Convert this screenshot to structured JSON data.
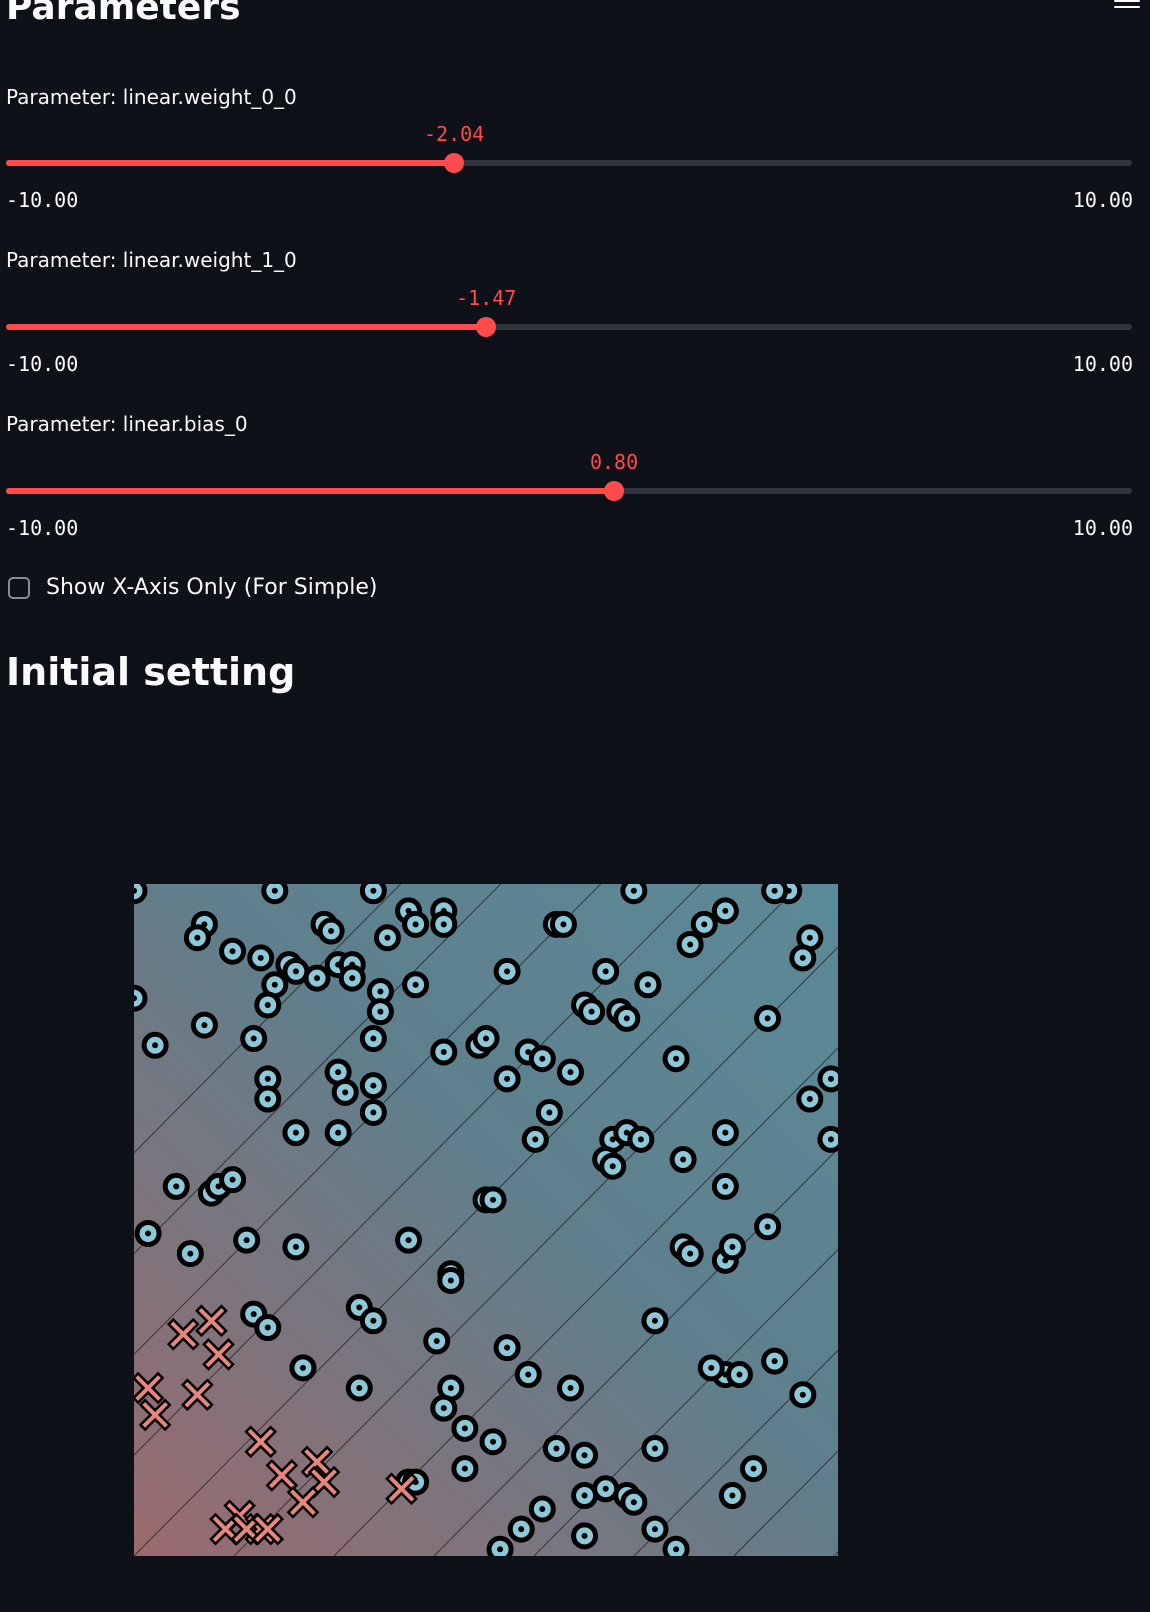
{
  "header": {
    "title": "Parameters",
    "menu_icon": "hamburger-menu-icon"
  },
  "sliders": [
    {
      "label": "Parameter: linear.weight_0_0",
      "value": -2.04,
      "value_text": "-2.04",
      "min_text": "-10.00",
      "max_text": "10.00",
      "min": -10,
      "max": 10
    },
    {
      "label": "Parameter: linear.weight_1_0",
      "value": -1.47,
      "value_text": "-1.47",
      "min_text": "-10.00",
      "max_text": "10.00",
      "min": -10,
      "max": 10
    },
    {
      "label": "Parameter: linear.bias_0",
      "value": 0.8,
      "value_text": "0.80",
      "min_text": "-10.00",
      "max_text": "10.00",
      "min": -10,
      "max": 10
    }
  ],
  "checkbox": {
    "label": "Show X-Axis Only (For Simple)",
    "checked": false
  },
  "section": {
    "title": "Initial setting"
  },
  "colors": {
    "background": "#0e1117",
    "accent": "#ff4b4b",
    "track": "#31333f",
    "class_circle": "#8cc8d8",
    "class_cross": "#e8857d",
    "grad_red": "#9a6a6e",
    "grad_blue": "#5b8a98"
  },
  "chart_data": {
    "type": "scatter",
    "title": "",
    "xlabel": "",
    "ylabel": "",
    "xlim": [
      0,
      1
    ],
    "ylim": [
      0,
      1
    ],
    "grid": false,
    "legend": "none",
    "contour_lines": true,
    "series": [
      {
        "marker": "circle-dot",
        "color": "#8cc8d8",
        "points": [
          [
            0.0,
            0.99
          ],
          [
            0.2,
            0.99
          ],
          [
            0.34,
            0.99
          ],
          [
            0.39,
            0.96
          ],
          [
            0.44,
            0.96
          ],
          [
            0.71,
            0.99
          ],
          [
            0.84,
            0.96
          ],
          [
            0.93,
            0.99
          ],
          [
            0.91,
            0.99
          ],
          [
            0.1,
            0.94
          ],
          [
            0.09,
            0.92
          ],
          [
            0.27,
            0.94
          ],
          [
            0.28,
            0.93
          ],
          [
            0.36,
            0.92
          ],
          [
            0.4,
            0.94
          ],
          [
            0.44,
            0.94
          ],
          [
            0.6,
            0.94
          ],
          [
            0.61,
            0.94
          ],
          [
            0.81,
            0.94
          ],
          [
            0.96,
            0.92
          ],
          [
            0.14,
            0.9
          ],
          [
            0.18,
            0.89
          ],
          [
            0.22,
            0.88
          ],
          [
            0.26,
            0.86
          ],
          [
            0.23,
            0.87
          ],
          [
            0.29,
            0.88
          ],
          [
            0.2,
            0.85
          ],
          [
            0.31,
            0.88
          ],
          [
            0.53,
            0.87
          ],
          [
            0.67,
            0.87
          ],
          [
            0.0,
            0.83
          ],
          [
            0.31,
            0.86
          ],
          [
            0.35,
            0.84
          ],
          [
            0.4,
            0.85
          ],
          [
            0.79,
            0.91
          ],
          [
            0.95,
            0.89
          ],
          [
            0.73,
            0.85
          ],
          [
            0.1,
            0.79
          ],
          [
            0.19,
            0.82
          ],
          [
            0.17,
            0.77
          ],
          [
            0.35,
            0.81
          ],
          [
            0.34,
            0.77
          ],
          [
            0.64,
            0.82
          ],
          [
            0.65,
            0.81
          ],
          [
            0.69,
            0.81
          ],
          [
            0.7,
            0.8
          ],
          [
            0.9,
            0.8
          ],
          [
            0.03,
            0.76
          ],
          [
            0.44,
            0.75
          ],
          [
            0.49,
            0.76
          ],
          [
            0.5,
            0.77
          ],
          [
            0.56,
            0.75
          ],
          [
            0.58,
            0.74
          ],
          [
            0.62,
            0.72
          ],
          [
            0.77,
            0.74
          ],
          [
            0.19,
            0.71
          ],
          [
            0.29,
            0.72
          ],
          [
            0.19,
            0.68
          ],
          [
            0.3,
            0.69
          ],
          [
            0.34,
            0.7
          ],
          [
            0.53,
            0.71
          ],
          [
            0.96,
            0.68
          ],
          [
            0.99,
            0.71
          ],
          [
            0.23,
            0.63
          ],
          [
            0.29,
            0.63
          ],
          [
            0.34,
            0.66
          ],
          [
            0.59,
            0.66
          ],
          [
            0.57,
            0.62
          ],
          [
            0.68,
            0.62
          ],
          [
            0.7,
            0.63
          ],
          [
            0.72,
            0.62
          ],
          [
            0.84,
            0.63
          ],
          [
            0.99,
            0.62
          ],
          [
            0.06,
            0.55
          ],
          [
            0.11,
            0.54
          ],
          [
            0.12,
            0.55
          ],
          [
            0.14,
            0.56
          ],
          [
            0.67,
            0.59
          ],
          [
            0.68,
            0.58
          ],
          [
            0.78,
            0.59
          ],
          [
            0.84,
            0.55
          ],
          [
            0.02,
            0.48
          ],
          [
            0.08,
            0.45
          ],
          [
            0.16,
            0.47
          ],
          [
            0.23,
            0.46
          ],
          [
            0.39,
            0.47
          ],
          [
            0.5,
            0.53
          ],
          [
            0.51,
            0.53
          ],
          [
            0.78,
            0.46
          ],
          [
            0.79,
            0.45
          ],
          [
            0.84,
            0.44
          ],
          [
            0.85,
            0.46
          ],
          [
            0.9,
            0.49
          ],
          [
            0.45,
            0.42
          ],
          [
            0.45,
            0.41
          ],
          [
            0.74,
            0.35
          ],
          [
            0.17,
            0.36
          ],
          [
            0.19,
            0.34
          ],
          [
            0.32,
            0.37
          ],
          [
            0.34,
            0.35
          ],
          [
            0.43,
            0.32
          ],
          [
            0.24,
            0.28
          ],
          [
            0.56,
            0.27
          ],
          [
            0.53,
            0.31
          ],
          [
            0.84,
            0.27
          ],
          [
            0.86,
            0.27
          ],
          [
            0.82,
            0.28
          ],
          [
            0.91,
            0.29
          ],
          [
            0.95,
            0.24
          ],
          [
            0.32,
            0.25
          ],
          [
            0.45,
            0.25
          ],
          [
            0.44,
            0.22
          ],
          [
            0.62,
            0.25
          ],
          [
            0.47,
            0.19
          ],
          [
            0.51,
            0.17
          ],
          [
            0.47,
            0.13
          ],
          [
            0.6,
            0.16
          ],
          [
            0.64,
            0.15
          ],
          [
            0.74,
            0.16
          ],
          [
            0.88,
            0.13
          ],
          [
            0.39,
            0.11
          ],
          [
            0.4,
            0.11
          ],
          [
            0.58,
            0.07
          ],
          [
            0.64,
            0.09
          ],
          [
            0.67,
            0.1
          ],
          [
            0.7,
            0.09
          ],
          [
            0.71,
            0.08
          ],
          [
            0.85,
            0.09
          ],
          [
            0.55,
            0.04
          ],
          [
            0.64,
            0.03
          ],
          [
            0.74,
            0.04
          ],
          [
            0.77,
            0.01
          ],
          [
            0.52,
            0.01
          ]
        ]
      },
      {
        "marker": "x",
        "color": "#e8857d",
        "points": [
          [
            0.11,
            0.35
          ],
          [
            0.07,
            0.33
          ],
          [
            0.12,
            0.3
          ],
          [
            0.02,
            0.25
          ],
          [
            0.09,
            0.24
          ],
          [
            0.03,
            0.21
          ],
          [
            0.18,
            0.17
          ],
          [
            0.26,
            0.14
          ],
          [
            0.21,
            0.12
          ],
          [
            0.27,
            0.11
          ],
          [
            0.24,
            0.08
          ],
          [
            0.38,
            0.1
          ],
          [
            0.15,
            0.06
          ],
          [
            0.18,
            0.04
          ],
          [
            0.13,
            0.04
          ],
          [
            0.16,
            0.04
          ],
          [
            0.19,
            0.04
          ]
        ]
      }
    ]
  }
}
